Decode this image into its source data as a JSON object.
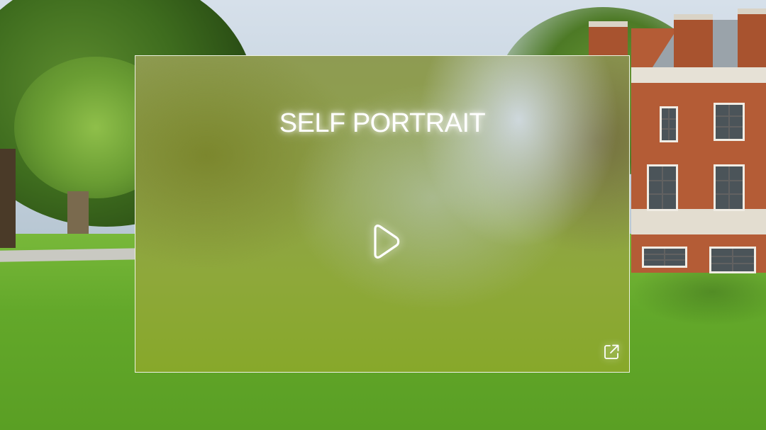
{
  "card": {
    "title": "SELF PORTRAIT",
    "play_icon": "play-icon",
    "open_icon": "external-link-icon"
  },
  "colors": {
    "title_text": "#ffffff",
    "card_border": "#ffffff"
  }
}
